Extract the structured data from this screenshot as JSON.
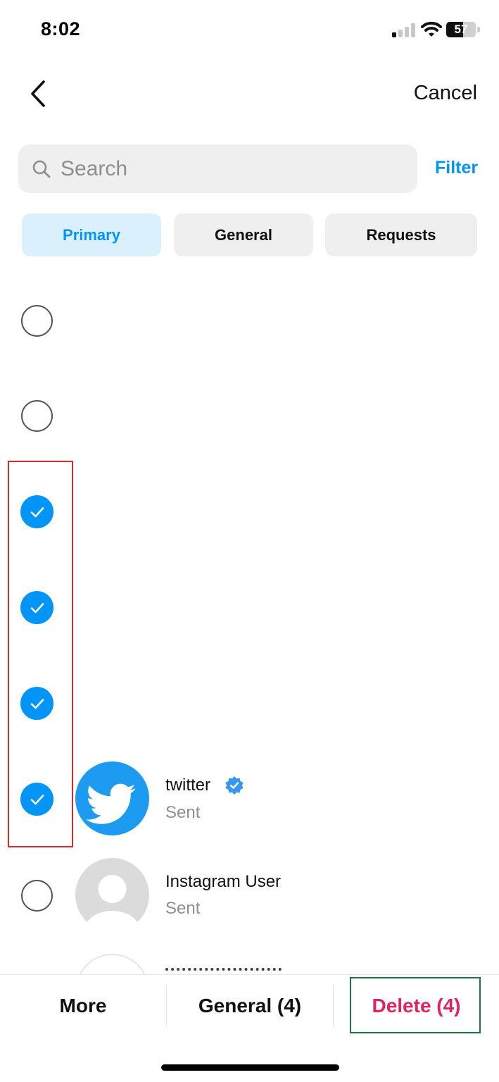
{
  "status_bar": {
    "time": "8:02",
    "battery": "57"
  },
  "header": {
    "cancel_label": "Cancel"
  },
  "search": {
    "placeholder": "Search",
    "filter_label": "Filter"
  },
  "tabs": [
    {
      "label": "Primary",
      "active": true
    },
    {
      "label": "General",
      "active": false
    },
    {
      "label": "Requests",
      "active": false
    }
  ],
  "threads": [
    {
      "selected": false
    },
    {
      "selected": false
    },
    {
      "selected": true
    },
    {
      "selected": true
    },
    {
      "selected": true
    },
    {
      "name": "twitter",
      "verified": true,
      "status": "Sent",
      "selected": true,
      "avatar": "twitter-bird-icon"
    },
    {
      "name": "Instagram User",
      "status": "Sent",
      "selected": false,
      "avatar": "default-user-icon"
    }
  ],
  "toolbar": {
    "more_label": "More",
    "move_label": "General (4)",
    "delete_label": "Delete (4)"
  },
  "colors": {
    "accent": "#0095f6",
    "delete": "#e0245e",
    "annotation_red": "#d42a2a",
    "annotation_green": "#157a3c"
  }
}
